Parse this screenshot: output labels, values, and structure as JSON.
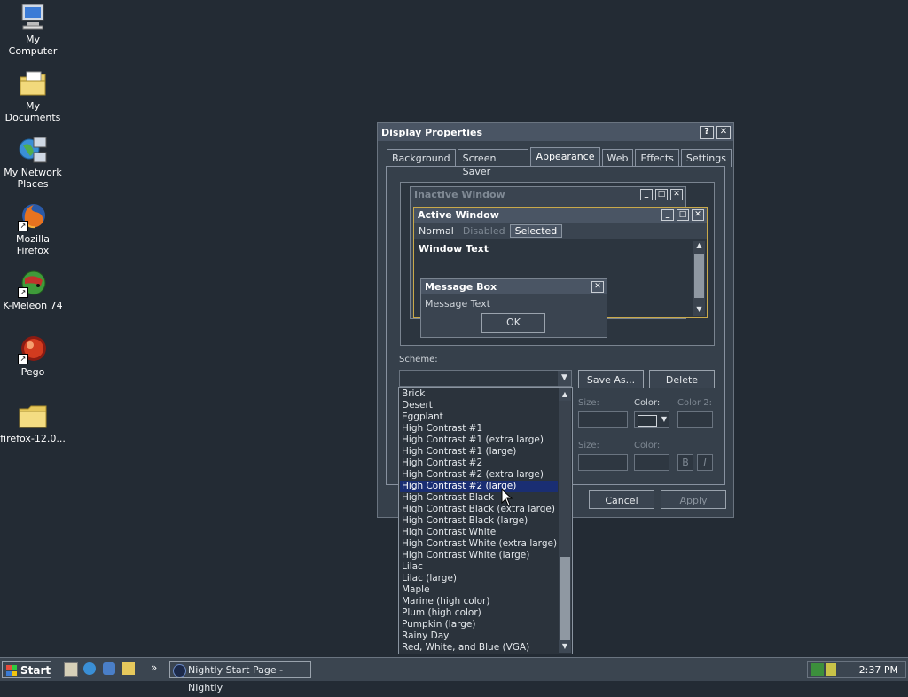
{
  "desktop": {
    "icons": [
      {
        "label": "My Computer"
      },
      {
        "label": "My Documents"
      },
      {
        "label": "My Network Places"
      },
      {
        "label": "Mozilla Firefox"
      },
      {
        "label": "K-Meleon 74"
      },
      {
        "label": "Pego"
      },
      {
        "label": "firefox-12.0..."
      }
    ]
  },
  "window": {
    "title": "Display Properties",
    "help_btn": "?",
    "close_btn": "✕",
    "tabs": [
      {
        "label": "Background"
      },
      {
        "label": "Screen Saver"
      },
      {
        "label": "Appearance"
      },
      {
        "label": "Web"
      },
      {
        "label": "Effects"
      },
      {
        "label": "Settings"
      }
    ],
    "active_tab": "Appearance"
  },
  "preview": {
    "inactive_title": "Inactive Window",
    "active_title": "Active Window",
    "menu_normal": "Normal",
    "menu_disabled": "Disabled",
    "menu_selected": "Selected",
    "window_text": "Window Text",
    "msgbox_title": "Message Box",
    "msgbox_text": "Message Text",
    "ok": "OK"
  },
  "scheme": {
    "label": "Scheme:",
    "save_as": "Save As...",
    "delete": "Delete"
  },
  "item_controls": {
    "size_label": "Size:",
    "color_label": "Color:",
    "color2_label": "Color 2:",
    "font_size_label": "Size:",
    "font_color_label": "Color:",
    "bold": "B",
    "italic": "I"
  },
  "buttons": {
    "cancel": "Cancel",
    "apply": "Apply"
  },
  "scheme_list": {
    "items": [
      "Brick",
      "Desert",
      "Eggplant",
      "High Contrast #1",
      "High Contrast #1 (extra large)",
      "High Contrast #1 (large)",
      "High Contrast #2",
      "High Contrast #2 (extra large)",
      "High Contrast #2 (large)",
      "High Contrast Black",
      "High Contrast Black (extra large)",
      "High Contrast Black (large)",
      "High Contrast White",
      "High Contrast White (extra large)",
      "High Contrast White (large)",
      "Lilac",
      "Lilac (large)",
      "Maple",
      "Marine (high color)",
      "Plum (high color)",
      "Pumpkin (large)",
      "Rainy Day",
      "Red, White, and Blue (VGA)"
    ],
    "selected": "High Contrast #2 (large)"
  },
  "taskbar": {
    "start": "Start",
    "task": "Nightly Start Page - Nightly",
    "chevron": "»",
    "clock": "2:37 PM"
  }
}
